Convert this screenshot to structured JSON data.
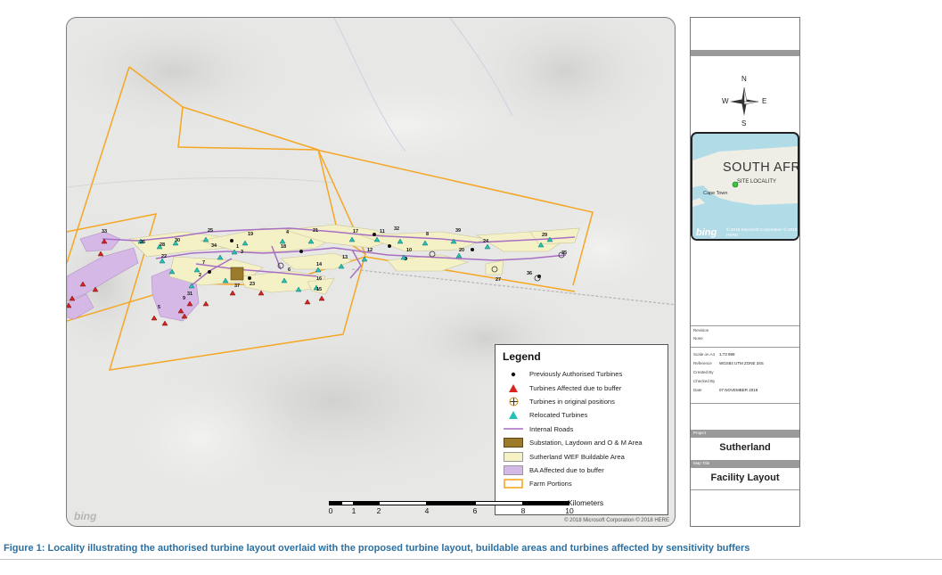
{
  "map": {
    "labels": [
      "33",
      "26",
      "28",
      "30",
      "25",
      "19",
      "4",
      "21",
      "17",
      "11",
      "32",
      "8",
      "39",
      "24",
      "29",
      "22",
      "34",
      "1",
      "18",
      "12",
      "10",
      "20",
      "31",
      "36",
      "7",
      "9",
      "3",
      "14",
      "13",
      "16",
      "27",
      "35",
      "2",
      "5",
      "6",
      "15",
      "37",
      "23"
    ],
    "bing_logo": "bing",
    "copyright": "© 2018 Microsoft Corporation © 2018 HERE"
  },
  "legend": {
    "title": "Legend",
    "items": [
      {
        "label": "Previously Authorised Turbines",
        "symbol": "dot-black"
      },
      {
        "label": "Turbines Affected due to buffer",
        "symbol": "triangle-red"
      },
      {
        "label": "Turbines in original positions",
        "symbol": "cross-circle"
      },
      {
        "label": "Relocated Turbines",
        "symbol": "triangle-teal"
      },
      {
        "label": "Internal Roads",
        "symbol": "line-purple"
      },
      {
        "label": "Substation, Laydown and O & M Area",
        "symbol": "fill-brown"
      },
      {
        "label": "Sutherland WEF Buildable Area",
        "symbol": "fill-cream"
      },
      {
        "label": "BA Affected due to buffer",
        "symbol": "fill-lavender"
      },
      {
        "label": "Farm Portions",
        "symbol": "outline-orange"
      }
    ]
  },
  "scale": {
    "ticks": [
      "0",
      "1",
      "2",
      "4",
      "6",
      "8",
      "10"
    ],
    "unit": "Kilometers"
  },
  "compass": {
    "n": "N",
    "s": "S",
    "e": "E",
    "w": "W"
  },
  "locality": {
    "country": "SOUTH AFRI",
    "site": "SITE LOCALITY",
    "town": "Cape Town",
    "bing": "bing",
    "copyright": "© 2018 Microsoft Corporation © 2018 HERE"
  },
  "panel": {
    "revision_label": "Revision",
    "revision_value": "None",
    "scale_label": "Scale on A4",
    "scale_value": "1:73 998",
    "reference_label": "Reference",
    "reference_value": "WGS84 UTM ZONE 34S",
    "created_label": "Created By",
    "checked_label": "Checked By",
    "date_label": "Date",
    "date_value": "07 NOVEMBER 2019",
    "project_label": "Project",
    "project_value": "Sutherland",
    "map_title_label": "Map Title",
    "map_title_value": "Facility Layout"
  },
  "caption": "Figure 1: Locality illustrating the authorised turbine layout overlaid with the proposed turbine layout, buildable areas and turbines affected by sensitivity buffers",
  "colors": {
    "farm_boundary": "#f5a623",
    "road": "#a86fc4",
    "buildable": "#f4f1c6",
    "ba_affected": "#d6b8e6",
    "substation": "#9c7a2b",
    "relocated": "#23c2b5",
    "affected": "#d8231f",
    "caption": "#2d6f9f"
  }
}
